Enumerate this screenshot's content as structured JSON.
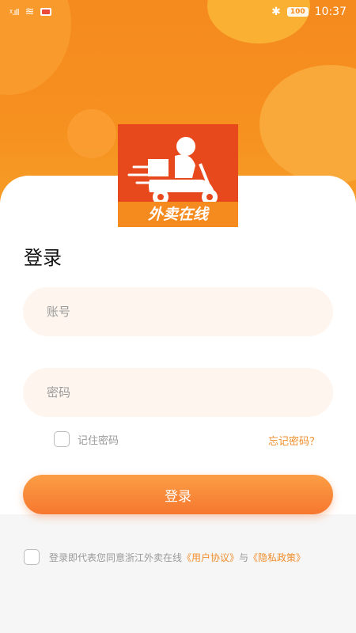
{
  "status_bar": {
    "signal": "ᵡ.ıll",
    "wifi_glyph": "≋",
    "bluetooth_glyph": "✱",
    "battery": "100",
    "time": "10:37"
  },
  "logo": {
    "text": "外卖在线"
  },
  "login": {
    "title": "登录",
    "account_placeholder": "账号",
    "password_placeholder": "密码",
    "remember_label": "记住密码",
    "forgot_label": "忘记密码？",
    "button_label": "登录"
  },
  "agreement": {
    "prefix": "登录即代表您同意浙江外卖在线",
    "user_agreement": "《用户协议》",
    "conjunction": "与",
    "privacy_policy": "《隐私政策》"
  },
  "colors": {
    "accent": "#f58a1f",
    "link": "#f08e2c",
    "field_bg": "#fef5ef",
    "logo_bg": "#e8491c"
  }
}
